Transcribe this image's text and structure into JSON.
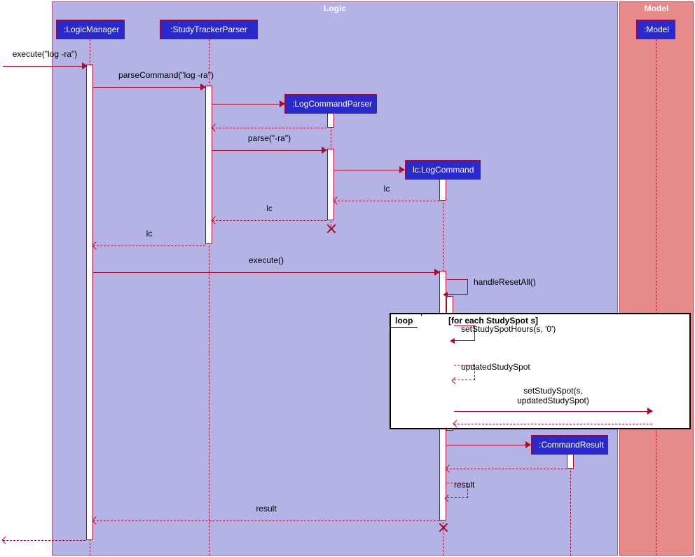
{
  "frames": {
    "logic": "Logic",
    "model": "Model"
  },
  "participants": {
    "logicManager": ":LogicManager",
    "studyTrackerParser": ":StudyTrackerParser",
    "logCommandParser": ":LogCommandParser",
    "logCommand": "lc:LogCommand",
    "commandResult": ":CommandResult",
    "model": ":Model"
  },
  "messages": {
    "executeIn": "execute(\"log -ra\")",
    "parseCommand": "parseCommand(\"log -ra\")",
    "parse": "parse(\"-ra\")",
    "lcReturn1": "lc",
    "lcReturn2": "lc",
    "lcReturn3": "lc",
    "execute": "execute()",
    "handleResetAll": "handleResetAll()",
    "setStudySpotHours": "setStudySpotHours(s, '0')",
    "updatedStudySpot": "updatedStudySpot",
    "setStudySpot": "setStudySpot(s, updatedStudySpot)",
    "result1": "result",
    "result2": "result"
  },
  "loop": {
    "label": "loop",
    "condition": "[for each StudySpot s]"
  }
}
